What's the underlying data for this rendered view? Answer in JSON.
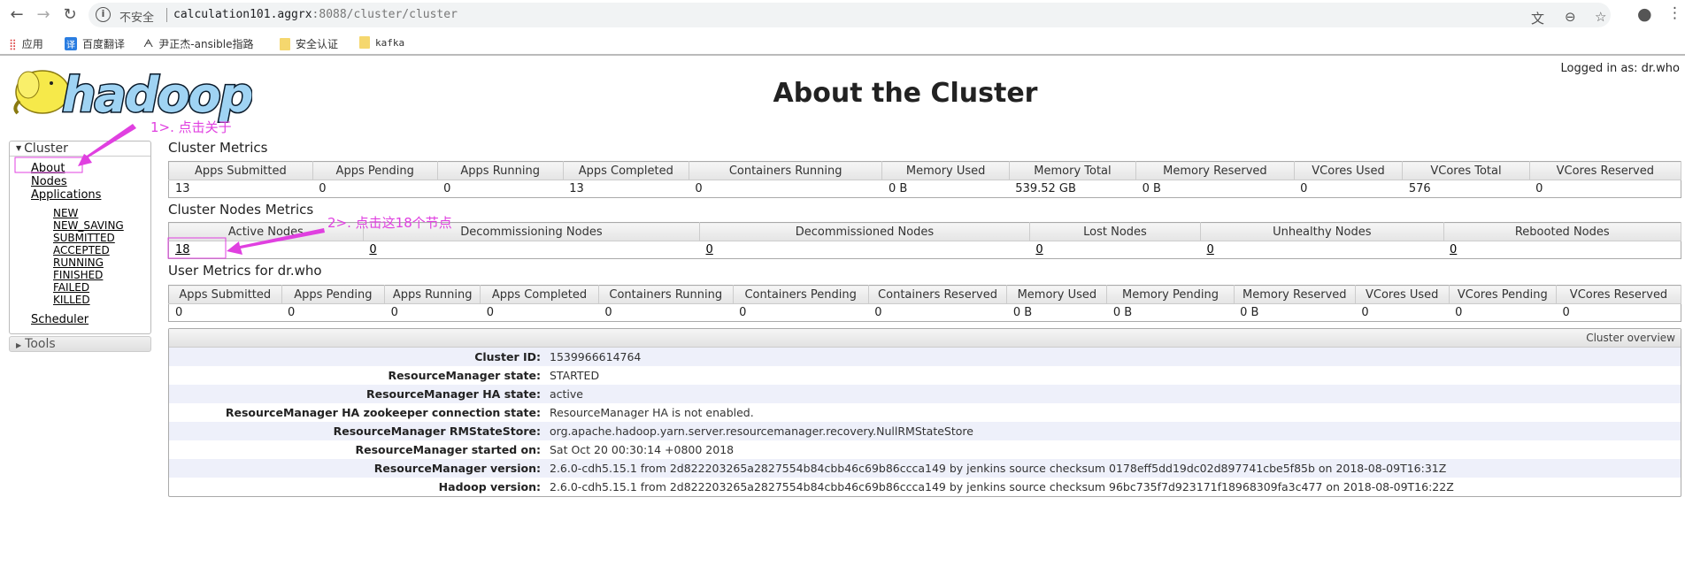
{
  "browser": {
    "insecure_label": "不安全",
    "url_host": "calculation101.aggrx",
    "url_rest": ":8088/cluster/cluster",
    "bookmarks": [
      {
        "label": "应用",
        "icon": "apps-grid-icon"
      },
      {
        "label": "百度翻译",
        "icon": "translate-icon"
      },
      {
        "label": "尹正杰-ansible指路",
        "icon": "bookmark-icon"
      },
      {
        "label": "安全认证",
        "icon": "folder-icon"
      },
      {
        "label": "kafka",
        "icon": "folder-icon"
      }
    ]
  },
  "header": {
    "logo_text": "hadoop",
    "title": "About the Cluster",
    "logged_in": "Logged in as: dr.who"
  },
  "sidebar": {
    "cluster_label": "Cluster",
    "items": [
      "About",
      "Nodes",
      "Applications"
    ],
    "app_states": [
      "NEW",
      "NEW_SAVING",
      "SUBMITTED",
      "ACCEPTED",
      "RUNNING",
      "FINISHED",
      "FAILED",
      "KILLED"
    ],
    "scheduler": "Scheduler",
    "tools_label": "Tools"
  },
  "cluster_metrics": {
    "title": "Cluster Metrics",
    "headers": [
      "Apps Submitted",
      "Apps Pending",
      "Apps Running",
      "Apps Completed",
      "Containers Running",
      "Memory Used",
      "Memory Total",
      "Memory Reserved",
      "VCores Used",
      "VCores Total",
      "VCores Reserved"
    ],
    "values": [
      "13",
      "0",
      "0",
      "13",
      "0",
      "0 B",
      "539.52 GB",
      "0 B",
      "0",
      "576",
      "0"
    ]
  },
  "nodes_metrics": {
    "title": "Cluster Nodes Metrics",
    "headers": [
      "Active Nodes",
      "Decommissioning Nodes",
      "Decommissioned Nodes",
      "Lost Nodes",
      "Unhealthy Nodes",
      "Rebooted Nodes"
    ],
    "values": [
      "18",
      "0",
      "0",
      "0",
      "0",
      "0"
    ]
  },
  "user_metrics": {
    "title": "User Metrics for dr.who",
    "headers": [
      "Apps Submitted",
      "Apps Pending",
      "Apps Running",
      "Apps Completed",
      "Containers Running",
      "Containers Pending",
      "Containers Reserved",
      "Memory Used",
      "Memory Pending",
      "Memory Reserved",
      "VCores Used",
      "VCores Pending",
      "VCores Reserved"
    ],
    "values": [
      "0",
      "0",
      "0",
      "0",
      "0",
      "0",
      "0",
      "0 B",
      "0 B",
      "0 B",
      "0",
      "0",
      "0"
    ]
  },
  "overview": {
    "header": "Cluster overview",
    "rows": [
      {
        "key": "Cluster ID:",
        "value": "1539966614764"
      },
      {
        "key": "ResourceManager state:",
        "value": "STARTED"
      },
      {
        "key": "ResourceManager HA state:",
        "value": "active"
      },
      {
        "key": "ResourceManager HA zookeeper connection state:",
        "value": "ResourceManager HA is not enabled."
      },
      {
        "key": "ResourceManager RMStateStore:",
        "value": "org.apache.hadoop.yarn.server.resourcemanager.recovery.NullRMStateStore"
      },
      {
        "key": "ResourceManager started on:",
        "value": "Sat Oct 20 00:30:14 +0800 2018"
      },
      {
        "key": "ResourceManager version:",
        "value": "2.6.0-cdh5.15.1 from 2d822203265a2827554b84cbb46c69b86ccca149 by jenkins source checksum 0178eff5dd19dc02d897741cbe5f85b on 2018-08-09T16:31Z"
      },
      {
        "key": "Hadoop version:",
        "value": "2.6.0-cdh5.15.1 from 2d822203265a2827554b84cbb46c69b86ccca149 by jenkins source checksum 96bc735f7d923171f18968309fa3c477 on 2018-08-09T16:22Z"
      }
    ]
  },
  "annotations": {
    "step1": "1>. 点击关于",
    "step2": "2>. 点击这18个节点",
    "color": "#e040e0"
  }
}
